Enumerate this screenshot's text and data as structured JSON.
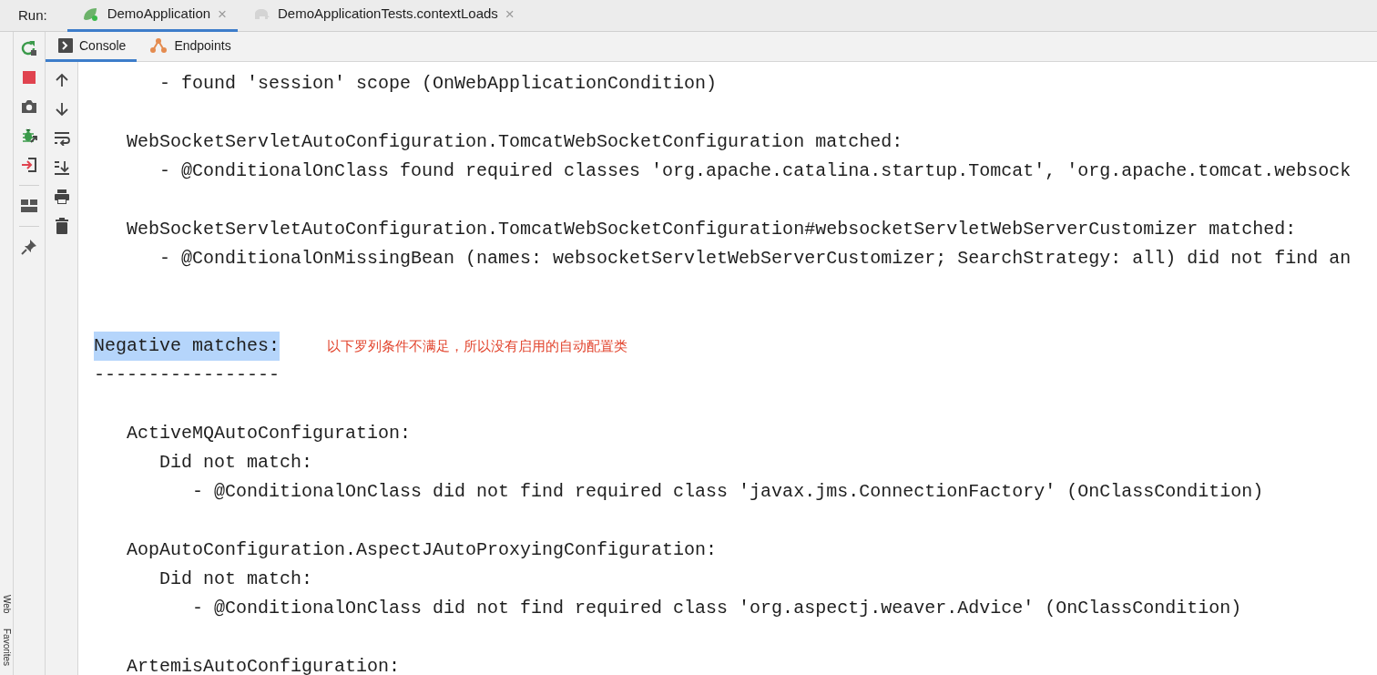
{
  "run_bar": {
    "label": "Run:",
    "tabs": [
      {
        "label": "DemoApplication",
        "kind": "spring",
        "selected": true,
        "close": "×"
      },
      {
        "label": "DemoApplicationTests.contextLoads",
        "kind": "elephant",
        "selected": false,
        "close": "×"
      }
    ]
  },
  "side_tabs": [
    {
      "label": "Web"
    },
    {
      "label": "Favorites"
    }
  ],
  "left_toolbar": [
    {
      "kind": "rerun"
    },
    {
      "kind": "stop"
    },
    {
      "kind": "camera"
    },
    {
      "kind": "bug"
    },
    {
      "kind": "exit"
    },
    {
      "kind": "separator"
    },
    {
      "kind": "layout"
    },
    {
      "kind": "separator"
    },
    {
      "kind": "pin"
    }
  ],
  "console_toolbar": [
    {
      "kind": "up"
    },
    {
      "kind": "down"
    },
    {
      "kind": "wrap"
    },
    {
      "kind": "scroll-end"
    },
    {
      "kind": "print"
    },
    {
      "kind": "trash"
    }
  ],
  "console_tabs": [
    {
      "label": "Console",
      "kind": "console",
      "selected": true
    },
    {
      "label": "Endpoints",
      "kind": "endpoints",
      "selected": false
    }
  ],
  "console_lines": [
    {
      "text": "      - found 'session' scope (OnWebApplicationCondition)"
    },
    {
      "kind": "blank"
    },
    {
      "text": "   WebSocketServletAutoConfiguration.TomcatWebSocketConfiguration matched:"
    },
    {
      "text": "      - @ConditionalOnClass found required classes 'org.apache.catalina.startup.Tomcat', 'org.apache.tomcat.websock"
    },
    {
      "kind": "blank"
    },
    {
      "text": "   WebSocketServletAutoConfiguration.TomcatWebSocketConfiguration#websocketServletWebServerCustomizer matched:"
    },
    {
      "text": "      - @ConditionalOnMissingBean (names: websocketServletWebServerCustomizer; SearchStrategy: all) did not find an"
    },
    {
      "kind": "blank"
    },
    {
      "kind": "blank"
    },
    {
      "text": "Negative matches:",
      "highlighted": true,
      "annotation": "以下罗列条件不满足，所以没有启用的自动配置类"
    },
    {
      "text": "-----------------"
    },
    {
      "kind": "blank"
    },
    {
      "text": "   ActiveMQAutoConfiguration:"
    },
    {
      "text": "      Did not match:"
    },
    {
      "text": "         - @ConditionalOnClass did not find required class 'javax.jms.ConnectionFactory' (OnClassCondition)"
    },
    {
      "kind": "blank"
    },
    {
      "text": "   AopAutoConfiguration.AspectJAutoProxyingConfiguration:"
    },
    {
      "text": "      Did not match:"
    },
    {
      "text": "         - @ConditionalOnClass did not find required class 'org.aspectj.weaver.Advice' (OnClassCondition)"
    },
    {
      "kind": "blank"
    },
    {
      "text": "   ArtemisAutoConfiguration:"
    }
  ]
}
